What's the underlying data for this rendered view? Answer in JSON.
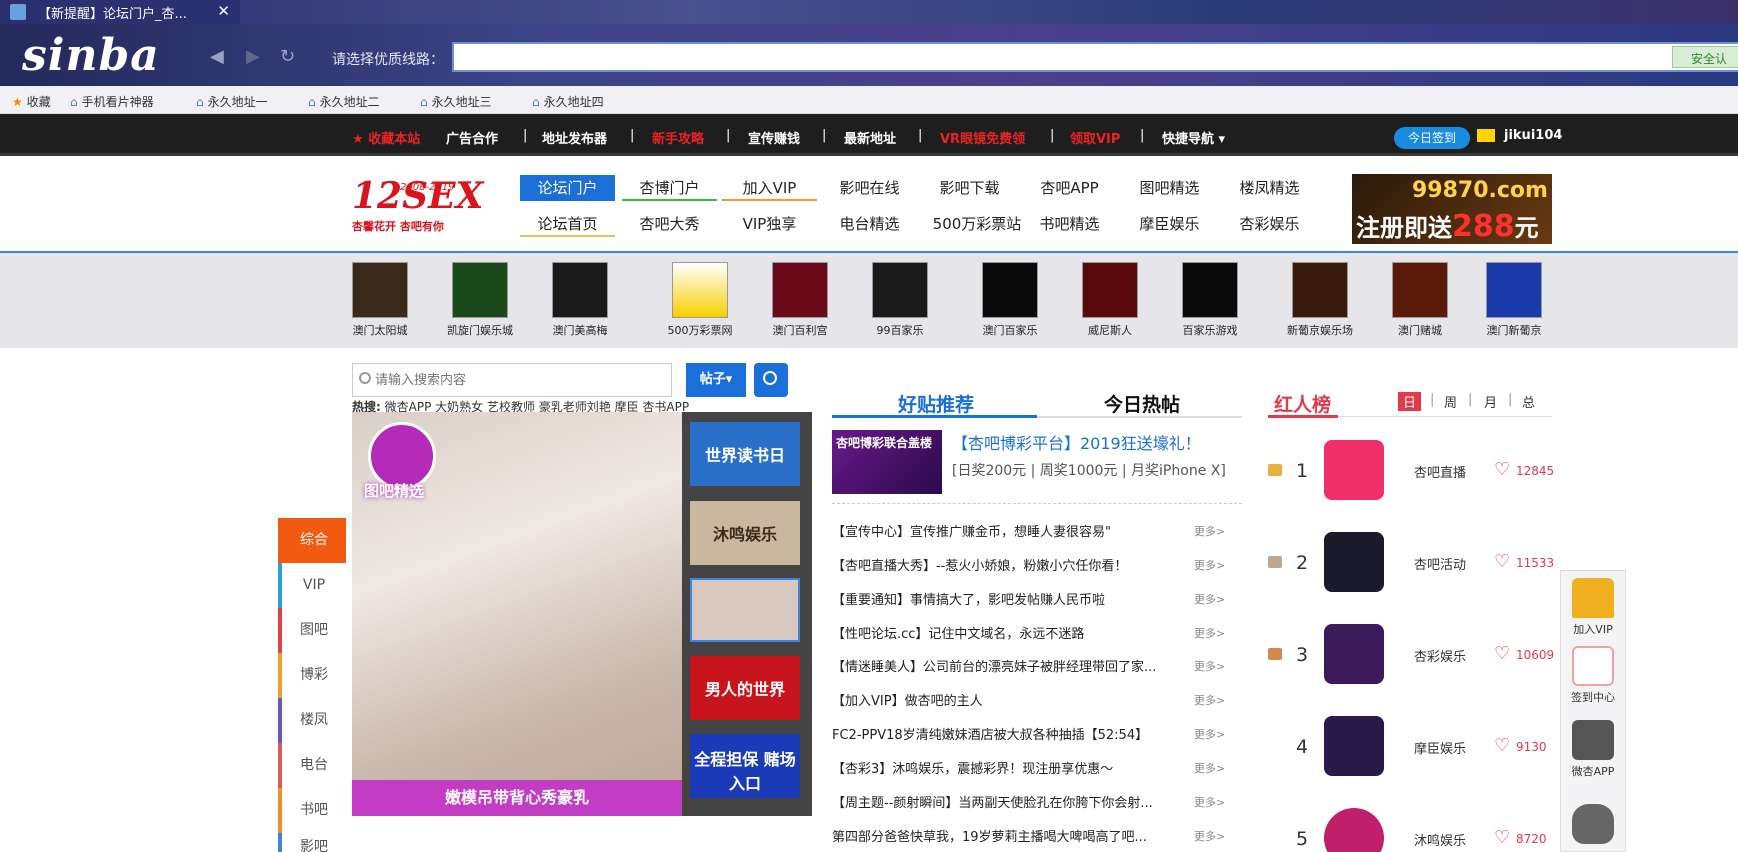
{
  "browser": {
    "tab_title": "【新提醒】论坛门户_杏...",
    "tab_close": "✕",
    "logo": "sinba",
    "back_icon": "◀",
    "forward_icon": "▶",
    "refresh_icon": "↻",
    "route_label": "请选择优质线路：",
    "route_value": "",
    "safe_badge": "安全认",
    "bookmarks": [
      "收藏",
      "手机看片神器",
      "永久地址一",
      "永久地址二",
      "永久地址三",
      "永久地址四"
    ]
  },
  "topbar": {
    "links": [
      {
        "label": "收藏本站",
        "red": true
      },
      {
        "label": "广告合作",
        "red": false
      },
      {
        "label": "地址发布器",
        "red": false
      },
      {
        "label": "新手攻略",
        "red": true
      },
      {
        "label": "宣传赚钱",
        "red": false
      },
      {
        "label": "最新地址",
        "red": false
      },
      {
        "label": "VR眼镜免费领",
        "red": true
      },
      {
        "label": "领取VIP",
        "red": true
      },
      {
        "label": "快捷导航",
        "red": false
      }
    ],
    "separator": "|",
    "signin": "今日签到",
    "username": "jikui104"
  },
  "header": {
    "logo_big": "12SEX",
    "logo_years": "2008-2019",
    "logo_sub": "杏馨花开 杏吧有你",
    "nav_row1": [
      "论坛门户",
      "杏博门户",
      "加入VIP",
      "影吧在线",
      "影吧下载",
      "杏吧APP",
      "图吧精选",
      "楼凤精选"
    ],
    "nav_row2": [
      "论坛首页",
      "杏吧大秀",
      "VIP独享",
      "电台精选",
      "500万彩票站",
      "书吧精选",
      "摩臣娱乐",
      "杏彩娱乐"
    ],
    "ad_top": {
      "line1": "99870.com",
      "line2a": "注册即送",
      "line2b": "288",
      "line2c": "元"
    }
  },
  "casinos": [
    "澳门太阳城",
    "凯旋门娱乐城",
    "澳门美高梅",
    "500万彩票网",
    "澳门百利宫",
    "99百家乐",
    "澳门百家乐",
    "威尼斯人",
    "百家乐游戏",
    "新葡京娱乐场",
    "澳门赌城",
    "澳门新葡京"
  ],
  "casino_colors": [
    "#3a2a1a",
    "#1a4a1a",
    "#1a1a1a",
    "#ffffff",
    "#6a0a1a",
    "#1a1a1a",
    "#0a0a0a",
    "#5a0a0a",
    "#0a0a0a",
    "#3a1a0a",
    "#5a1a0a",
    "#1a3aaa"
  ],
  "search": {
    "placeholder": "请输入搜索内容",
    "type": "帖子",
    "hot_prefix": "热搜:",
    "hot": "微杏APP 大奶熟女 艺校教师 豪乳老师刘艳 摩臣 杏书APP"
  },
  "panel": {
    "camera_label": "图吧精选",
    "caption": "嫩模吊带背心秀豪乳",
    "thumbs": [
      {
        "text": "世界读书日",
        "bg": "#2a70c8"
      },
      {
        "text": "沐鸣娱乐",
        "bg": "#c8b8a0"
      },
      {
        "text": "",
        "bg": "#d8c8c0"
      },
      {
        "text": "男人的世界",
        "bg": "#c8141c"
      },
      {
        "text": "全程担保 赌场入口",
        "bg": "#1a3ab8"
      }
    ]
  },
  "side_tabs": [
    "综合",
    "VIP",
    "图吧",
    "博彩",
    "楼凤",
    "电台",
    "书吧",
    "影吧"
  ],
  "side_tab_colors": [
    "#f25a12",
    "#2aa0e0",
    "#e0404a",
    "#f0a030",
    "#6a5ab0",
    "#e05a5a",
    "#f0902a",
    "#3a8ad0"
  ],
  "news": {
    "tab_good": "好贴推荐",
    "tab_hot": "今日热帖",
    "feat_img_text": "杏吧博彩联合盖楼",
    "feat_title": "【杏吧博彩平台】2019狂送壕礼！",
    "feat_sub": "[日奖200元 | 周奖1000元 | 月奖iPhone X]",
    "more": "更多>",
    "items": [
      "【宣传中心】宣传推广赚金币，想睡人妻很容易\"",
      "【杏吧直播大秀】--惹火小娇娘，粉嫩小穴任你看！",
      "【重要通知】事情搞大了，影吧发帖赚人民币啦",
      "【性吧论坛.cc】记住中文域名，永远不迷路",
      "【情迷睡美人】公司前台的漂亮妹子被胖经理带回了家...",
      "【加入VIP】做杏吧的主人",
      "FC2-PPV18岁清纯嫩妹酒店被大叔各种抽插【52:54】",
      "【杏彩3】沐鸣娱乐，震撼彩界！现注册享优惠～",
      "【周主题--颜射瞬间】当两副天使脸孔在你胯下你会射...",
      "第四部分爸爸快草我，19岁萝莉主播喝大啤喝高了吧..."
    ]
  },
  "ranking": {
    "title": "红人榜",
    "periods": [
      "日",
      "周",
      "月",
      "总"
    ],
    "rows": [
      {
        "rank": "1",
        "name": "杏吧直播",
        "count": "12845",
        "color": "#f0306a"
      },
      {
        "rank": "2",
        "name": "杏吧活动",
        "count": "11533",
        "color": "#1a1a2a"
      },
      {
        "rank": "3",
        "name": "杏彩娱乐",
        "count": "10609",
        "color": "#3a1a5a"
      },
      {
        "rank": "4",
        "name": "摩臣娱乐",
        "count": "9130",
        "color": "#2a1a4a"
      },
      {
        "rank": "5",
        "name": "沐鸣娱乐",
        "count": "8720",
        "color": "#c0206a"
      }
    ]
  },
  "float_bar": [
    {
      "label": "加入VIP",
      "color": "#f0b020"
    },
    {
      "label": "签到中心",
      "color": "#f0a0a0"
    },
    {
      "label": "微杏APP",
      "color": "#555555"
    },
    {
      "label": "",
      "color": "#666666"
    }
  ]
}
